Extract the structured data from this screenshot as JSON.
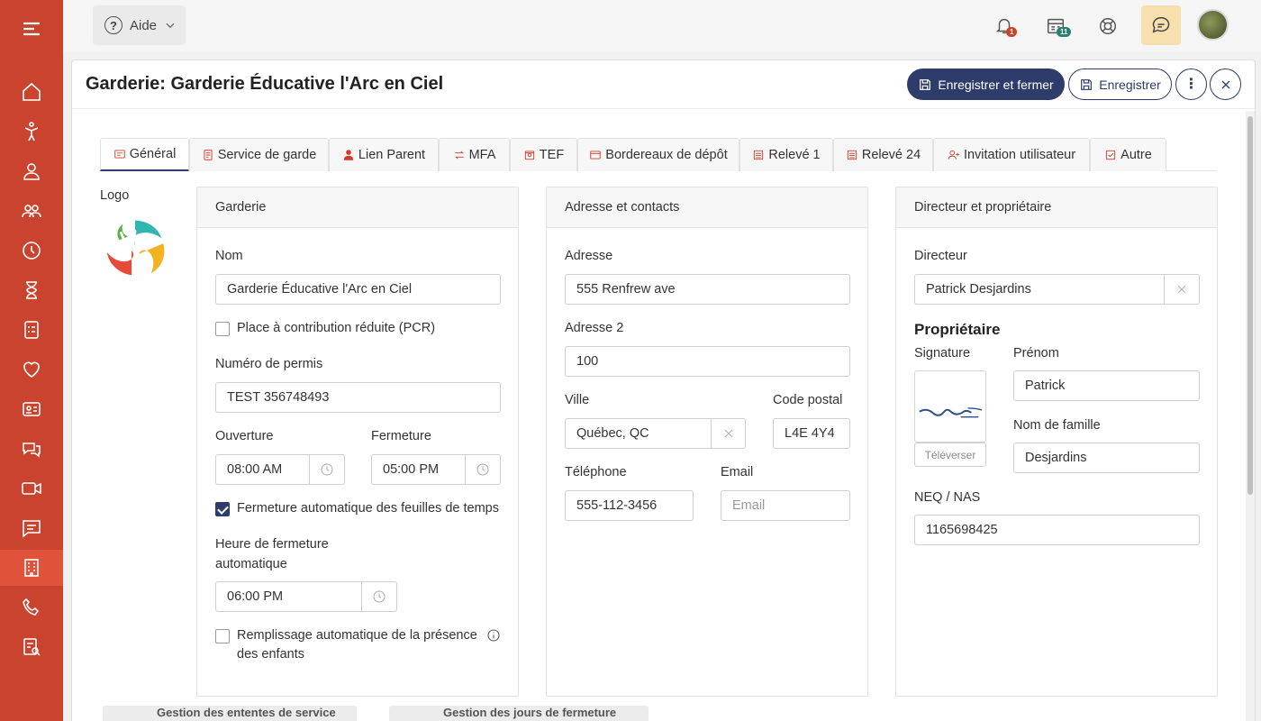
{
  "topbar": {
    "help_label": "Aide",
    "notifications_badge": "1",
    "calendar_badge": "11"
  },
  "panel": {
    "title": "Garderie: Garderie Éducative l'Arc en Ciel",
    "save_close_label": "Enregistrer et fermer",
    "save_label": "Enregistrer"
  },
  "tabs": [
    {
      "label": "Général",
      "icon": "card-icon"
    },
    {
      "label": "Service de garde",
      "icon": "document-icon"
    },
    {
      "label": "Lien Parent",
      "icon": "user-group-icon"
    },
    {
      "label": "MFA",
      "icon": "arrows-icon"
    },
    {
      "label": "TEF",
      "icon": "bank-icon"
    },
    {
      "label": "Bordereaux de dépôt",
      "icon": "window-icon"
    },
    {
      "label": "Relevé 1",
      "icon": "list-icon"
    },
    {
      "label": "Relevé 24",
      "icon": "list-icon"
    },
    {
      "label": "Invitation utilisateur",
      "icon": "user-plus-icon"
    },
    {
      "label": "Autre",
      "icon": "check-square-icon"
    }
  ],
  "logo_label": "Logo",
  "garderie": {
    "header": "Garderie",
    "nom_label": "Nom",
    "nom_value": "Garderie Éducative l'Arc en Ciel",
    "pcr_label": "Place à contribution réduite (PCR)",
    "pcr_checked": false,
    "permis_label": "Numéro de permis",
    "permis_value": "TEST 356748493",
    "ouverture_label": "Ouverture",
    "ouverture_value": "08:00 AM",
    "fermeture_label": "Fermeture",
    "fermeture_value": "05:00 PM",
    "auto_close_label": "Fermeture automatique des feuilles de temps",
    "auto_close_checked": true,
    "heure_fermeture_label_1": "Heure de fermeture",
    "heure_fermeture_label_2": "automatique",
    "heure_fermeture_value": "06:00 PM",
    "remplissage_label_1": "Remplissage automatique de la présence",
    "remplissage_label_2": "des enfants",
    "remplissage_checked": false
  },
  "adresse": {
    "header": "Adresse et contacts",
    "adresse_label": "Adresse",
    "adresse_value": "555 Renfrew ave",
    "adresse2_label": "Adresse 2",
    "adresse2_value": "100",
    "ville_label": "Ville",
    "ville_value": "Québec, QC",
    "code_postal_label": "Code postal",
    "code_postal_value": "L4E 4Y4",
    "telephone_label": "Téléphone",
    "telephone_value": "555-112-3456",
    "email_label": "Email",
    "email_placeholder": "Email"
  },
  "directeur": {
    "header": "Directeur et propriétaire",
    "directeur_label": "Directeur",
    "directeur_value": "Patrick Desjardins",
    "proprietaire_heading": "Propriétaire",
    "signature_label": "Signature",
    "upload_label": "Téléverser",
    "prenom_label": "Prénom",
    "prenom_value": "Patrick",
    "nom_famille_label": "Nom de famille",
    "nom_famille_value": "Desjardins",
    "neq_label": "NEQ / NAS",
    "neq_value": "1165698425"
  },
  "bottom": {
    "item1": "Gestion des ententes de service",
    "item2": "Gestion des jours de fermeture"
  },
  "colors": {
    "sidebar": "#c9432e",
    "primary": "#2d3c6b",
    "accent_icon": "#d23a2a"
  }
}
